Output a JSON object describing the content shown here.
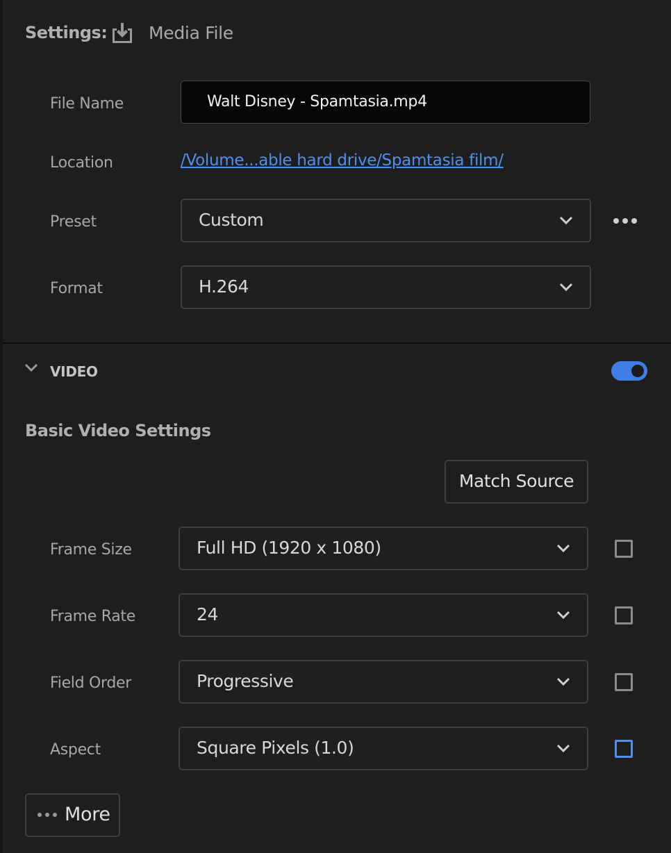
{
  "header": {
    "settings_label": "Settings:",
    "media_file_label": "Media File"
  },
  "file": {
    "name_label": "File Name",
    "name_value": "Walt Disney - Spamtasia.mp4",
    "location_label": "Location",
    "location_value": "/Volume...able hard drive/Spamtasia film/",
    "preset_label": "Preset",
    "preset_value": "Custom",
    "format_label": "Format",
    "format_value": "H.264"
  },
  "video": {
    "section_label": "VIDEO",
    "enabled": true,
    "basic_title": "Basic Video Settings",
    "match_source_label": "Match Source",
    "rows": [
      {
        "label": "Frame Size",
        "value": "Full HD (1920 x 1080)",
        "checked": false
      },
      {
        "label": "Frame Rate",
        "value": "24",
        "checked": false
      },
      {
        "label": "Field Order",
        "value": "Progressive",
        "checked": false
      },
      {
        "label": "Aspect",
        "value": "Square Pixels (1.0)",
        "checked": false
      }
    ],
    "more_label": "More"
  },
  "colors": {
    "accent": "#4e8ff1",
    "toggle_on": "#3f7fe3",
    "background": "#1e1e1e"
  }
}
